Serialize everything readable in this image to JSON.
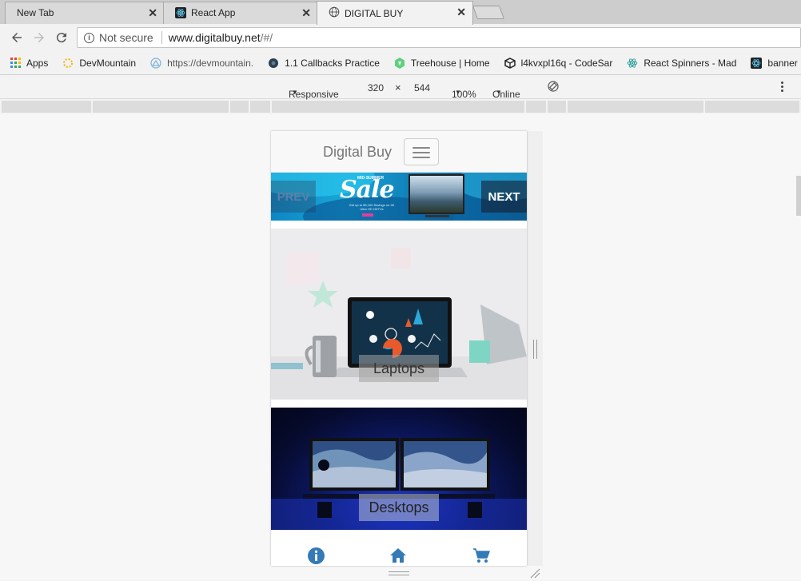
{
  "tabs": [
    {
      "title": "New Tab",
      "active": false,
      "favicon": "none"
    },
    {
      "title": "React App",
      "active": false,
      "favicon": "react-icon"
    },
    {
      "title": "DIGITAL BUY",
      "active": true,
      "favicon": "globe-icon"
    }
  ],
  "omnibox": {
    "security_label": "Not secure",
    "url_host": "www.digitalbuy.net",
    "url_path": "/#/"
  },
  "bookmarks": [
    {
      "label": "Apps",
      "icon": "apps-grid-icon"
    },
    {
      "label": "DevMountain",
      "icon": "devmountain-icon"
    },
    {
      "label": "https://devmountain.",
      "icon": "devmountain-triangle-icon"
    },
    {
      "label": "1.1 Callbacks Practice",
      "icon": "dark-circle-icon"
    },
    {
      "label": "Treehouse | Home",
      "icon": "treehouse-icon"
    },
    {
      "label": "l4kvxpl16q - CodeSar",
      "icon": "codesandbox-icon"
    },
    {
      "label": "React Spinners - Mad",
      "icon": "react-icon"
    },
    {
      "label": "banner",
      "icon": "react-square-icon"
    }
  ],
  "device_toolbar": {
    "mode": "Responsive",
    "width": "320",
    "separator": "×",
    "height": "544",
    "zoom": "100%",
    "network": "Online"
  },
  "site": {
    "brand": "Digital Buy",
    "carousel": {
      "prev_label": "PREV",
      "next_label": "NEXT",
      "banner_headline": "Sale",
      "banner_kicker": "MID-SUMMER",
      "banner_fine_print": "Get up to $3,100 Savings on 4K Ultra HD HDTVs"
    },
    "categories": [
      {
        "label": "Laptops"
      },
      {
        "label": "Desktops"
      }
    ],
    "bottom_nav": [
      {
        "icon": "info-icon"
      },
      {
        "icon": "home-icon"
      },
      {
        "icon": "cart-icon"
      }
    ]
  },
  "colors": {
    "link_blue": "#337ab7",
    "brand_gray": "#777777"
  }
}
